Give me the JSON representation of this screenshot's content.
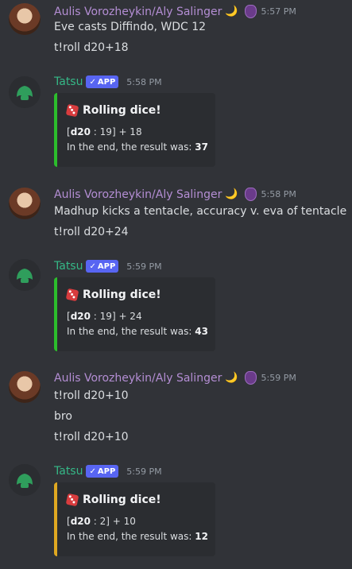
{
  "messages": [
    {
      "author": "Aulis Vorozheykin/Aly Salinger",
      "moon": "🌙",
      "time": "5:57 PM",
      "lines": [
        "Eve casts Diffindo, WDC 12",
        "t!roll d20+18"
      ]
    },
    {
      "author": "Tatsu",
      "app_tag": "APP",
      "time": "5:58 PM",
      "embed": {
        "title": "Rolling dice!",
        "roll_die": "d20",
        "roll_value": "19",
        "roll_mod": "+ 18",
        "result_text": "In the end, the result was:",
        "result": "37",
        "color": "#2cbd2c"
      }
    },
    {
      "author": "Aulis Vorozheykin/Aly Salinger",
      "moon": "🌙",
      "time": "5:58 PM",
      "lines": [
        "Madhup kicks a tentacle, accuracy v. eva of tentacle",
        "t!roll d20+24"
      ]
    },
    {
      "author": "Tatsu",
      "app_tag": "APP",
      "time": "5:59 PM",
      "embed": {
        "title": "Rolling dice!",
        "roll_die": "d20",
        "roll_value": "19",
        "roll_mod": "+ 24",
        "result_text": "In the end, the result was:",
        "result": "43",
        "color": "#2cbd2c"
      }
    },
    {
      "author": "Aulis Vorozheykin/Aly Salinger",
      "moon": "🌙",
      "time": "5:59 PM",
      "lines": [
        "t!roll d20+10",
        "bro",
        "t!roll d20+10"
      ]
    },
    {
      "author": "Tatsu",
      "app_tag": "APP",
      "time": "5:59 PM",
      "embed": {
        "title": "Rolling dice!",
        "roll_die": "d20",
        "roll_value": "2",
        "roll_mod": "+ 10",
        "result_text": "In the end, the result was:",
        "result": "12",
        "color": "#e0a821"
      }
    }
  ]
}
